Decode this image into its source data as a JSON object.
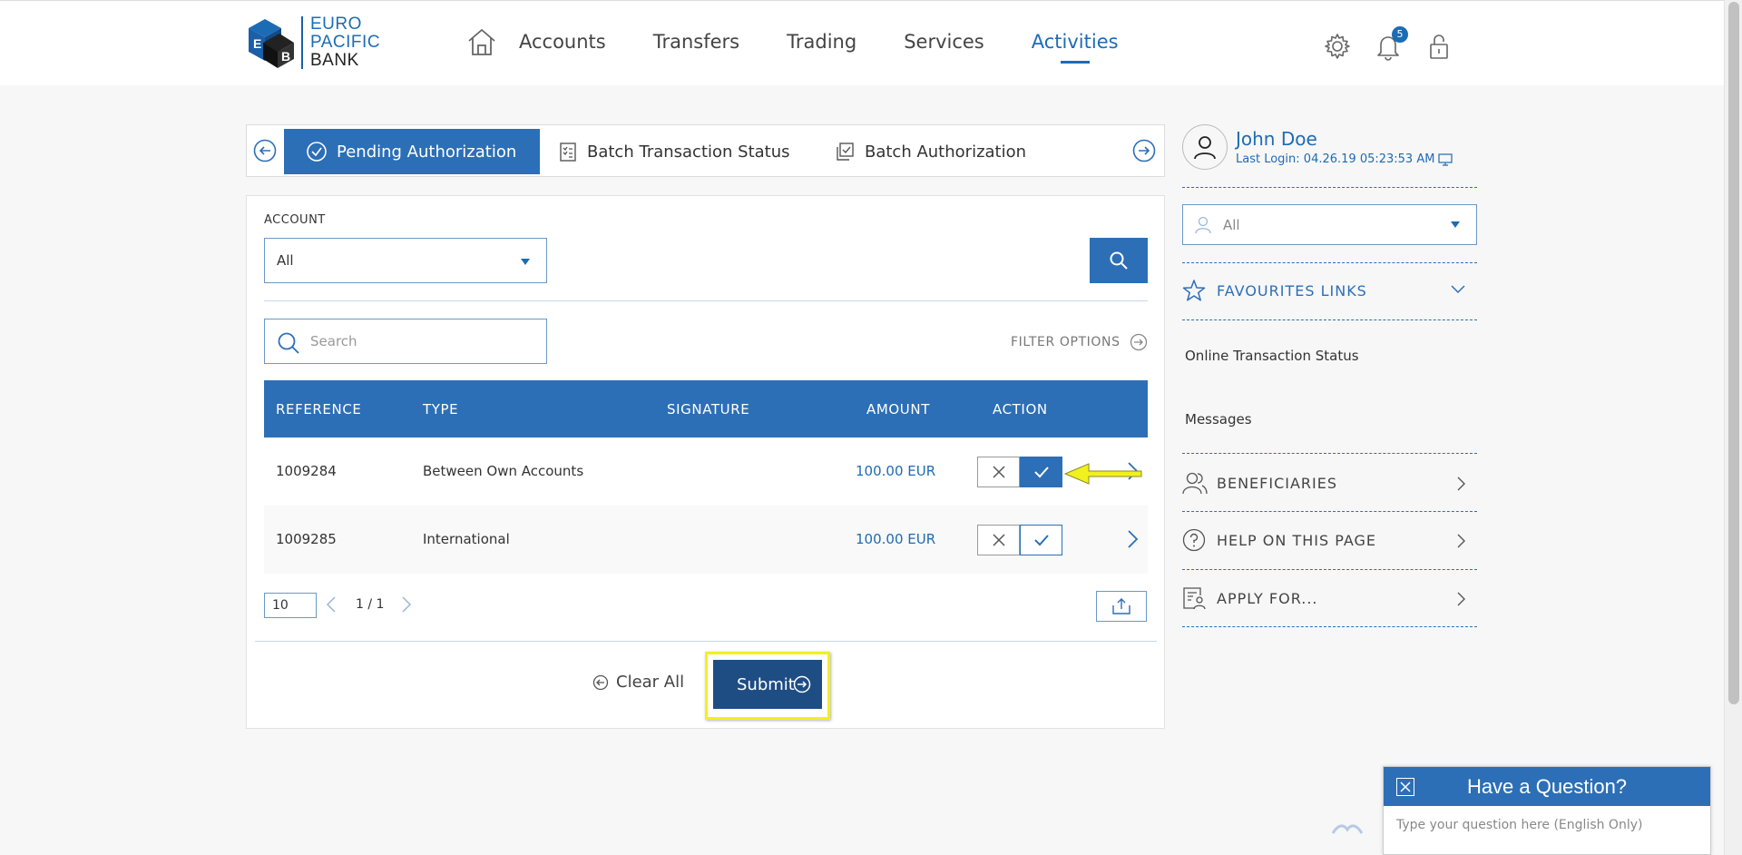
{
  "brand": {
    "line1": "EURO",
    "line2": "PACIFIC",
    "line3": "BANK",
    "accent": "#1c6cb5"
  },
  "nav": {
    "home_icon": "home-icon",
    "items": [
      {
        "label": "Accounts"
      },
      {
        "label": "Transfers"
      },
      {
        "label": "Trading"
      },
      {
        "label": "Services"
      },
      {
        "label": "Activities",
        "active": true
      }
    ],
    "notifications_count": "5"
  },
  "tabs": [
    {
      "label": "Pending Authorization",
      "icon": "check-circle-icon",
      "active": true
    },
    {
      "label": "Batch Transaction Status",
      "icon": "checklist-icon"
    },
    {
      "label": "Batch Authorization",
      "icon": "copy-check-icon"
    }
  ],
  "filters": {
    "account_label": "ACCOUNT",
    "account_value": "All",
    "search_placeholder": "Search",
    "filter_options_label": "FILTER OPTIONS"
  },
  "table": {
    "headers": [
      "REFERENCE",
      "TYPE",
      "SIGNATURE",
      "AMOUNT",
      "ACTION"
    ],
    "rows": [
      {
        "reference": "1009284",
        "type": "Between Own Accounts",
        "signature": "",
        "amount": "100.00 EUR",
        "approved": true
      },
      {
        "reference": "1009285",
        "type": "International",
        "signature": "",
        "amount": "100.00 EUR",
        "approved": false
      }
    ]
  },
  "pager": {
    "page_size": "10",
    "page_text": "1 / 1"
  },
  "actions": {
    "clear_all": "Clear All",
    "submit": "Submit"
  },
  "user": {
    "name": "John Doe",
    "last_login": "Last Login: 04.26.19 05:23:53 AM"
  },
  "sidebar": {
    "select_value": "All",
    "favourites_label": "FAVOURITES LINKS",
    "links": [
      "Online Transaction Status",
      "Messages"
    ],
    "items": [
      {
        "label": "BENEFICIARIES",
        "icon": "people-icon"
      },
      {
        "label": "HELP ON THIS PAGE",
        "icon": "question-circle-icon"
      },
      {
        "label": "APPLY FOR...",
        "icon": "form-user-icon"
      }
    ]
  },
  "chat": {
    "title": "Have a Question?",
    "placeholder": "Type your question here (English Only)"
  },
  "colors": {
    "primary": "#2c6fb7",
    "dark_primary": "#1e4d84",
    "highlight": "#f2f01d"
  }
}
